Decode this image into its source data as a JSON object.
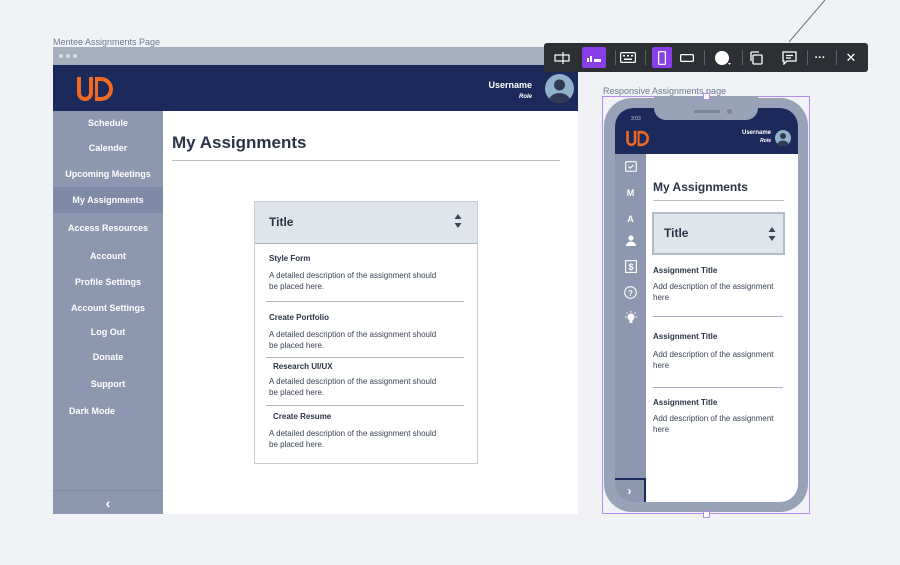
{
  "frames": {
    "desktop_label": "Mentee Assignments Page",
    "mobile_label": "Responsive Assignments page"
  },
  "header": {
    "username": "Username",
    "role": "Role"
  },
  "sidebar": {
    "items": [
      {
        "label": "Schedule"
      },
      {
        "label": "Calender"
      },
      {
        "label": "Upcoming Meetings"
      },
      {
        "label": "My Assignments"
      },
      {
        "label": "Access Resources"
      },
      {
        "label": "Account"
      },
      {
        "label": "Profile Settings"
      },
      {
        "label": "Account Settings"
      },
      {
        "label": "Log Out"
      },
      {
        "label": "Donate"
      },
      {
        "label": "Support"
      },
      {
        "label": "Dark Mode"
      }
    ],
    "collapse_glyph": "‹"
  },
  "main": {
    "page_title": "My Assignments",
    "table_header": "Title",
    "assignments": [
      {
        "title": "Style Form",
        "description": "A detailed description of the assignment should be placed here."
      },
      {
        "title": "Create Portfolio",
        "description": "A detailed description of the assignment should be placed here."
      },
      {
        "title": "Research UI/UX",
        "description": "A detailed description of the assignment should be placed here."
      },
      {
        "title": "Create Resume",
        "description": "A detailed description of the assignment should be placed here."
      }
    ]
  },
  "mobile": {
    "status_time": "3:03",
    "rail_letters": [
      "M",
      "A"
    ],
    "page_title": "My Assignments",
    "table_header": "Title",
    "assignments": [
      {
        "title": "Assignment Title",
        "description": "Add description of the assignment here"
      },
      {
        "title": "Assignment Title",
        "description": "Add description of the assignment here"
      },
      {
        "title": "Assignment Title",
        "description": "Add description of the assignment here"
      }
    ],
    "expand_glyph": "›"
  },
  "toolbar": {
    "more_glyph": "···",
    "close_glyph": "✕"
  },
  "colors": {
    "header_navy": "#1b2a5a",
    "sidebar_slate": "#8d97b0",
    "logo_orange": "#f26a21",
    "toolbar_dark": "#2c2f34",
    "toolbar_accent": "#8a3ee8"
  }
}
